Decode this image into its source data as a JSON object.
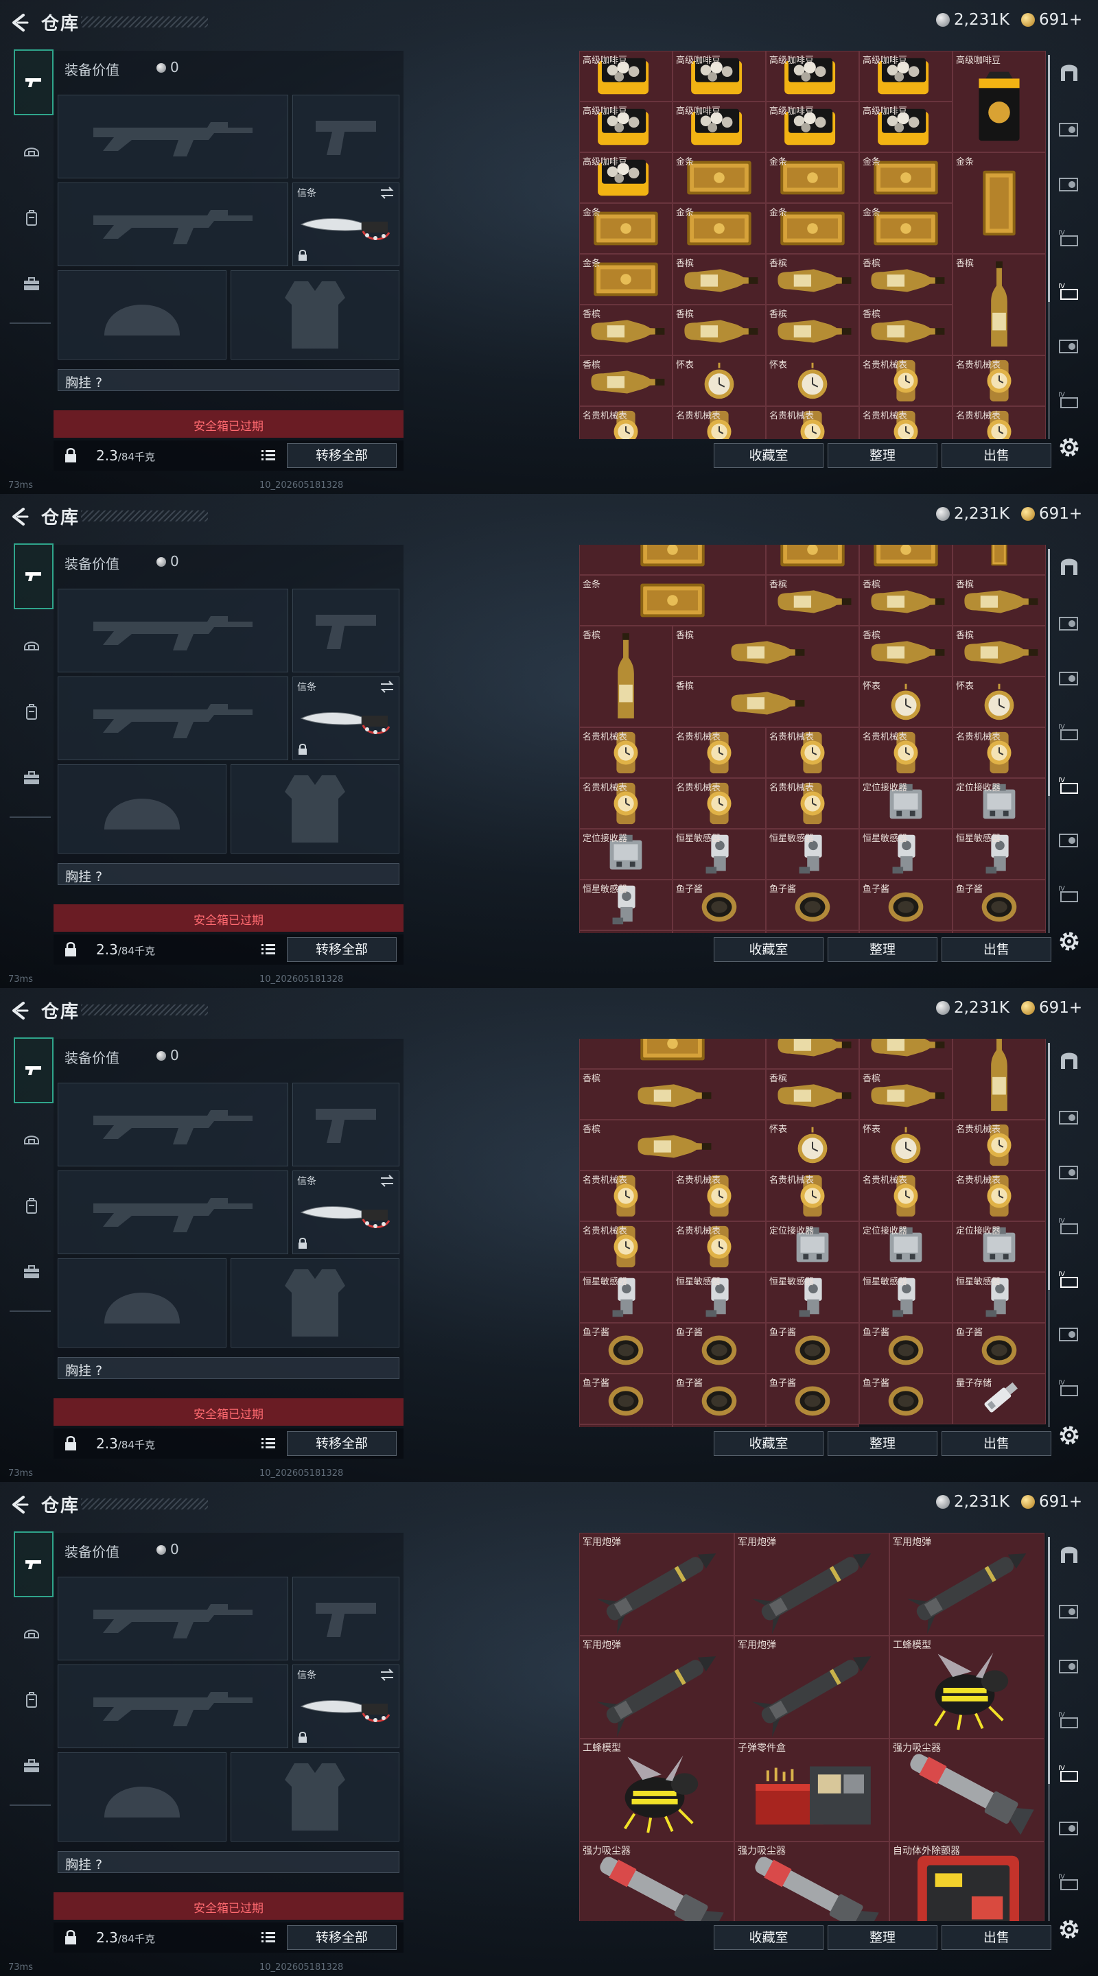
{
  "header": {
    "title": "仓库",
    "silver": "2,231K",
    "gold": "691+"
  },
  "loadout": {
    "value_label": "装备价值",
    "value": "0",
    "knife_label": "信条",
    "chest_label": "胸挂 ?",
    "safe_box": "安全箱已过期",
    "weight": "2.3",
    "weight_cap": "/84千克",
    "transfer_all": "转移全部"
  },
  "footer": {
    "ping": "73ms",
    "build": "10_202605181328"
  },
  "stash_buttons": {
    "collection": "收藏室",
    "sort": "整理",
    "sell": "出售"
  },
  "colors": {
    "cell_bg": "#4c2128",
    "accent_tab": "#2fa58b",
    "safe_bar": "#6a1c24"
  },
  "screens": [
    {
      "cells": [
        {
          "name": "高级咖啡豆",
          "kind": "coffee"
        },
        {
          "name": "高级咖啡豆",
          "kind": "coffee"
        },
        {
          "name": "高级咖啡豆",
          "kind": "coffee"
        },
        {
          "name": "高级咖啡豆",
          "kind": "coffee"
        },
        {
          "name": "高级咖啡豆",
          "kind": "coffeebag",
          "tall": true
        },
        {
          "name": "高级咖啡豆",
          "kind": "coffee"
        },
        {
          "name": "高级咖啡豆",
          "kind": "coffee"
        },
        {
          "name": "高级咖啡豆",
          "kind": "coffee"
        },
        {
          "name": "高级咖啡豆",
          "kind": "coffee"
        },
        {
          "name": "高级咖啡豆",
          "kind": "coffee"
        },
        {
          "name": "金条",
          "kind": "gold"
        },
        {
          "name": "金条",
          "kind": "gold"
        },
        {
          "name": "金条",
          "kind": "gold"
        },
        {
          "name": "金条",
          "kind": "goldv",
          "tall": true
        },
        {
          "name": "金条",
          "kind": "gold"
        },
        {
          "name": "金条",
          "kind": "gold"
        },
        {
          "name": "金条",
          "kind": "gold"
        },
        {
          "name": "金条",
          "kind": "gold"
        },
        {
          "name": "金条",
          "kind": "gold"
        },
        {
          "name": "香槟",
          "kind": "champ"
        },
        {
          "name": "香槟",
          "kind": "champ"
        },
        {
          "name": "香槟",
          "kind": "champ"
        },
        {
          "name": "香槟",
          "kind": "champv",
          "tall": true
        },
        {
          "name": "香槟",
          "kind": "champ"
        },
        {
          "name": "香槟",
          "kind": "champ"
        },
        {
          "name": "香槟",
          "kind": "champ"
        },
        {
          "name": "香槟",
          "kind": "champ"
        },
        {
          "name": "香槟",
          "kind": "champ"
        },
        {
          "name": "怀表",
          "kind": "pocketwatch"
        },
        {
          "name": "怀表",
          "kind": "pocketwatch"
        },
        {
          "name": "名贵机械表",
          "kind": "watch"
        },
        {
          "name": "名贵机械表",
          "kind": "watch"
        },
        {
          "name": "名贵机械表",
          "kind": "watch"
        },
        {
          "name": "名贵机械表",
          "kind": "watch"
        },
        {
          "name": "名贵机械表",
          "kind": "watch"
        },
        {
          "name": "名贵机械表",
          "kind": "watch"
        },
        {
          "name": "名贵机械表",
          "kind": "watch"
        },
        {
          "name": "定位接收器",
          "kind": "receiver"
        },
        {
          "name": "定位接收器",
          "kind": "receiver"
        },
        {
          "name": "恒星敏感器",
          "kind": "sensor"
        }
      ]
    },
    {
      "cells": [
        {
          "name": "金条",
          "kind": "gold",
          "wide": true
        },
        {
          "name": "",
          "kind": "gold"
        },
        {
          "name": "",
          "kind": "gold"
        },
        {
          "name": "",
          "kind": "goldv"
        },
        {
          "name": "金条",
          "kind": "gold",
          "wide": true
        },
        {
          "name": "香槟",
          "kind": "champ"
        },
        {
          "name": "香槟",
          "kind": "champ"
        },
        {
          "name": "香槟",
          "kind": "champ"
        },
        {
          "name": "香槟",
          "kind": "champv",
          "tall": true
        },
        {
          "name": "香槟",
          "kind": "champ",
          "wide": true
        },
        {
          "name": "香槟",
          "kind": "champ"
        },
        {
          "name": "香槟",
          "kind": "champ"
        },
        {
          "name": "香槟",
          "kind": "champ",
          "wide": true
        },
        {
          "name": "怀表",
          "kind": "pocketwatch"
        },
        {
          "name": "怀表",
          "kind": "pocketwatch"
        },
        {
          "name": "名贵机械表",
          "kind": "watch"
        },
        {
          "name": "名贵机械表",
          "kind": "watch"
        },
        {
          "name": "名贵机械表",
          "kind": "watch"
        },
        {
          "name": "名贵机械表",
          "kind": "watch"
        },
        {
          "name": "名贵机械表",
          "kind": "watch"
        },
        {
          "name": "名贵机械表",
          "kind": "watch"
        },
        {
          "name": "名贵机械表",
          "kind": "watch"
        },
        {
          "name": "名贵机械表",
          "kind": "watch"
        },
        {
          "name": "定位接收器",
          "kind": "receiver"
        },
        {
          "name": "定位接收器",
          "kind": "receiver"
        },
        {
          "name": "定位接收器",
          "kind": "receiver"
        },
        {
          "name": "恒星敏感器",
          "kind": "sensor"
        },
        {
          "name": "恒星敏感器",
          "kind": "sensor"
        },
        {
          "name": "恒星敏感器",
          "kind": "sensor"
        },
        {
          "name": "恒星敏感器",
          "kind": "sensor"
        },
        {
          "name": "恒星敏感器",
          "kind": "sensor"
        },
        {
          "name": "鱼子酱",
          "kind": "caviar"
        },
        {
          "name": "鱼子酱",
          "kind": "caviar"
        },
        {
          "name": "鱼子酱",
          "kind": "caviar"
        },
        {
          "name": "鱼子酱",
          "kind": "caviar"
        },
        {
          "name": "鱼子酱",
          "kind": "caviar"
        },
        {
          "name": "鱼子酱",
          "kind": "caviar"
        },
        {
          "name": "鱼子酱",
          "kind": "caviar"
        },
        {
          "name": "鱼子酱",
          "kind": "caviar"
        },
        {
          "name": "鱼子酱",
          "kind": "caviar"
        },
        {
          "name": "量子存储",
          "kind": "usb"
        },
        {
          "name": "量子存储",
          "kind": "usb"
        },
        {
          "name": "量子存储",
          "kind": "usb"
        },
        {
          "name": "量子存储",
          "kind": "usb"
        }
      ]
    },
    {
      "cells": [
        {
          "name": "金条",
          "kind": "gold",
          "wide": true
        },
        {
          "name": "香槟",
          "kind": "champ"
        },
        {
          "name": "香槟",
          "kind": "champ"
        },
        {
          "name": "香槟",
          "kind": "champv",
          "tall": true
        },
        {
          "name": "香槟",
          "kind": "champ",
          "wide": true
        },
        {
          "name": "香槟",
          "kind": "champ"
        },
        {
          "name": "香槟",
          "kind": "champ"
        },
        {
          "name": "香槟",
          "kind": "champ",
          "wide": true
        },
        {
          "name": "怀表",
          "kind": "pocketwatch"
        },
        {
          "name": "怀表",
          "kind": "pocketwatch"
        },
        {
          "name": "名贵机械表",
          "kind": "watch"
        },
        {
          "name": "名贵机械表",
          "kind": "watch"
        },
        {
          "name": "名贵机械表",
          "kind": "watch"
        },
        {
          "name": "名贵机械表",
          "kind": "watch"
        },
        {
          "name": "名贵机械表",
          "kind": "watch"
        },
        {
          "name": "名贵机械表",
          "kind": "watch"
        },
        {
          "name": "名贵机械表",
          "kind": "watch"
        },
        {
          "name": "名贵机械表",
          "kind": "watch"
        },
        {
          "name": "定位接收器",
          "kind": "receiver"
        },
        {
          "name": "定位接收器",
          "kind": "receiver"
        },
        {
          "name": "定位接收器",
          "kind": "receiver"
        },
        {
          "name": "恒星敏感器",
          "kind": "sensor"
        },
        {
          "name": "恒星敏感器",
          "kind": "sensor"
        },
        {
          "name": "恒星敏感器",
          "kind": "sensor"
        },
        {
          "name": "恒星敏感器",
          "kind": "sensor"
        },
        {
          "name": "恒星敏感器",
          "kind": "sensor"
        },
        {
          "name": "鱼子酱",
          "kind": "caviar"
        },
        {
          "name": "鱼子酱",
          "kind": "caviar"
        },
        {
          "name": "鱼子酱",
          "kind": "caviar"
        },
        {
          "name": "鱼子酱",
          "kind": "caviar"
        },
        {
          "name": "鱼子酱",
          "kind": "caviar"
        },
        {
          "name": "鱼子酱",
          "kind": "caviar"
        },
        {
          "name": "鱼子酱",
          "kind": "caviar"
        },
        {
          "name": "鱼子酱",
          "kind": "caviar"
        },
        {
          "name": "鱼子酱",
          "kind": "caviar"
        },
        {
          "name": "量子存储",
          "kind": "usb"
        },
        {
          "name": "量子存储",
          "kind": "usb"
        },
        {
          "name": "量子存储",
          "kind": "usb"
        },
        {
          "name": "量子存储",
          "kind": "usb"
        }
      ]
    },
    {
      "big": true,
      "cells": [
        {
          "name": "军用炮弹",
          "kind": "missile"
        },
        {
          "name": "军用炮弹",
          "kind": "missile"
        },
        {
          "name": "军用炮弹",
          "kind": "missile"
        },
        {
          "name": "军用炮弹",
          "kind": "missile"
        },
        {
          "name": "军用炮弹",
          "kind": "missile"
        },
        {
          "name": "工蜂模型",
          "kind": "bee"
        },
        {
          "name": "工蜂模型",
          "kind": "bee"
        },
        {
          "name": "子弹零件盒",
          "kind": "ammobox"
        },
        {
          "name": "强力吸尘器",
          "kind": "vacuum"
        },
        {
          "name": "强力吸尘器",
          "kind": "vacuum"
        },
        {
          "name": "强力吸尘器",
          "kind": "vacuum"
        },
        {
          "name": "自动体外除颤器",
          "kind": "aed"
        }
      ]
    }
  ]
}
